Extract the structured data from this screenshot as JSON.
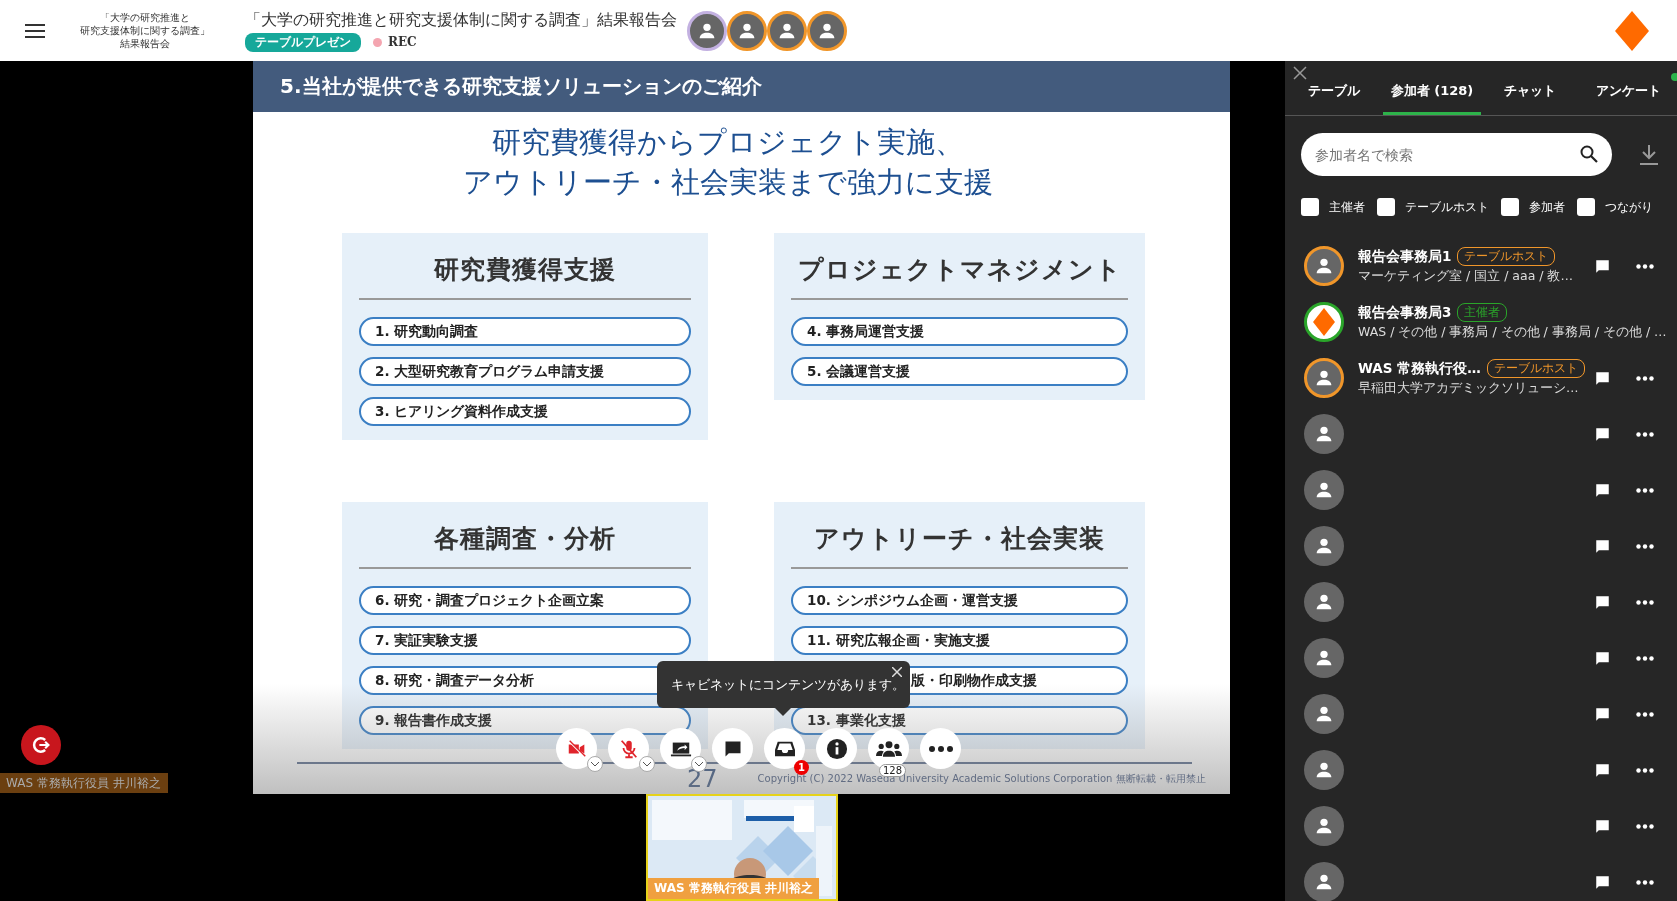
{
  "header": {
    "logo_lines": [
      "「大学の研究推進と",
      "研究支援体制に関する調査」",
      "結果報告会"
    ],
    "title": "「大学の研究推進と研究支援体制に関する調査」結果報告会",
    "tag": "テーブルプレゼン",
    "recording": "REC",
    "speakers": [
      {
        "color": "#c3b1e1"
      },
      {
        "color": "#f0962a"
      },
      {
        "color": "#f0962a"
      },
      {
        "color": "#f0962a"
      }
    ]
  },
  "stage": {
    "slide": {
      "heading": "5.当社が提供できる研究支援ソリューションのご紹介",
      "headline": [
        "研究費獲得からプロジェクト実施、",
        "アウトリーチ・社会実装まで強力に支援"
      ],
      "sections": [
        {
          "title": "研究費獲得支援",
          "items": [
            {
              "label": "1. 研究動向調査"
            },
            {
              "label": "2. 大型研究教育プログラム申請支援"
            },
            {
              "label": "3. ヒアリング資料作成支援"
            }
          ]
        },
        {
          "title": "プロジェクトマネジメント",
          "items": [
            {
              "label": "4. 事務局運営支援"
            },
            {
              "label": "5. 会議運営支援"
            }
          ]
        },
        {
          "title": "各種調査・分析",
          "items": [
            {
              "label": "6. 研究・調査プロジェクト企画立案"
            },
            {
              "label": "7. 実証実験支援"
            },
            {
              "label": "8. 研究・調査データ分析"
            },
            {
              "label": "9. 報告書作成支援"
            }
          ]
        },
        {
          "title": "アウトリーチ・社会実装",
          "items": [
            {
              "label": "10. シンポジウム企画・運営支援"
            },
            {
              "label": "11. 研究広報企画・実施支援"
            },
            {
              "label": "版・印刷物作成支援",
              "partly_hidden": true
            },
            {
              "label": "13. 事業化支援"
            }
          ]
        }
      ],
      "page_number": "27",
      "copyright": "Copyright (C) 2022 Waseda University Academic Solutions Corporation 無断転載・転用禁止"
    },
    "tooltip": "キャビネットにコンテンツがあります。",
    "controls": [
      {
        "kind": "camera",
        "off": true,
        "menu": true
      },
      {
        "kind": "mic",
        "off": true,
        "menu": true
      },
      {
        "kind": "share",
        "menu": true
      },
      {
        "kind": "chat"
      },
      {
        "kind": "cabinet",
        "badge": "1"
      },
      {
        "kind": "info"
      },
      {
        "kind": "participants",
        "count": "128"
      },
      {
        "kind": "more"
      }
    ],
    "presenter_label": "WAS 常務執行役員 井川裕之",
    "video": {
      "kind": "picture",
      "name_label": "WAS 常務執行役員 井川裕之"
    }
  },
  "panel": {
    "tabs": [
      {
        "label": "テーブル",
        "selected": false
      },
      {
        "label": "参加者 (128)",
        "selected": true
      },
      {
        "label": "チャット",
        "selected": false
      },
      {
        "label": "アンケート",
        "selected": false,
        "notification": true
      }
    ],
    "search": {
      "placeholder": "参加者名で検索"
    },
    "filters": [
      {
        "label": "主催者",
        "checked": false
      },
      {
        "label": "テーブルホスト",
        "checked": false
      },
      {
        "label": "参加者",
        "checked": false
      },
      {
        "label": "つながり",
        "checked": false
      }
    ],
    "participants": [
      {
        "name": "報告会事務局1",
        "role": {
          "label": "テーブルホスト",
          "kind": "host"
        },
        "detail": "マーケティング室 / 国立 / aaa / 教…",
        "kind": "person",
        "color": "#f0962a",
        "actions": true
      },
      {
        "name": "報告会事務局3",
        "role": {
          "label": "主催者",
          "kind": "organizer"
        },
        "detail": "WAS / その他 / 事務局 / その他 / 事務局 / その他 / …",
        "kind": "logo",
        "color": "#2aa52a",
        "actions": false
      },
      {
        "name": "WAS 常務執行役…",
        "role": {
          "label": "テーブルホスト",
          "kind": "host"
        },
        "detail": "早稲田大学アカデミックソリューシ…",
        "kind": "person",
        "color": "#f0962a",
        "actions": true
      },
      {
        "kind": "person",
        "actions": true
      },
      {
        "kind": "person",
        "actions": true
      },
      {
        "kind": "person",
        "actions": true
      },
      {
        "kind": "person",
        "actions": true
      },
      {
        "kind": "person",
        "actions": true
      },
      {
        "kind": "person",
        "actions": true
      },
      {
        "kind": "person",
        "actions": true
      },
      {
        "kind": "person",
        "actions": true
      },
      {
        "kind": "person",
        "actions": true
      }
    ]
  }
}
